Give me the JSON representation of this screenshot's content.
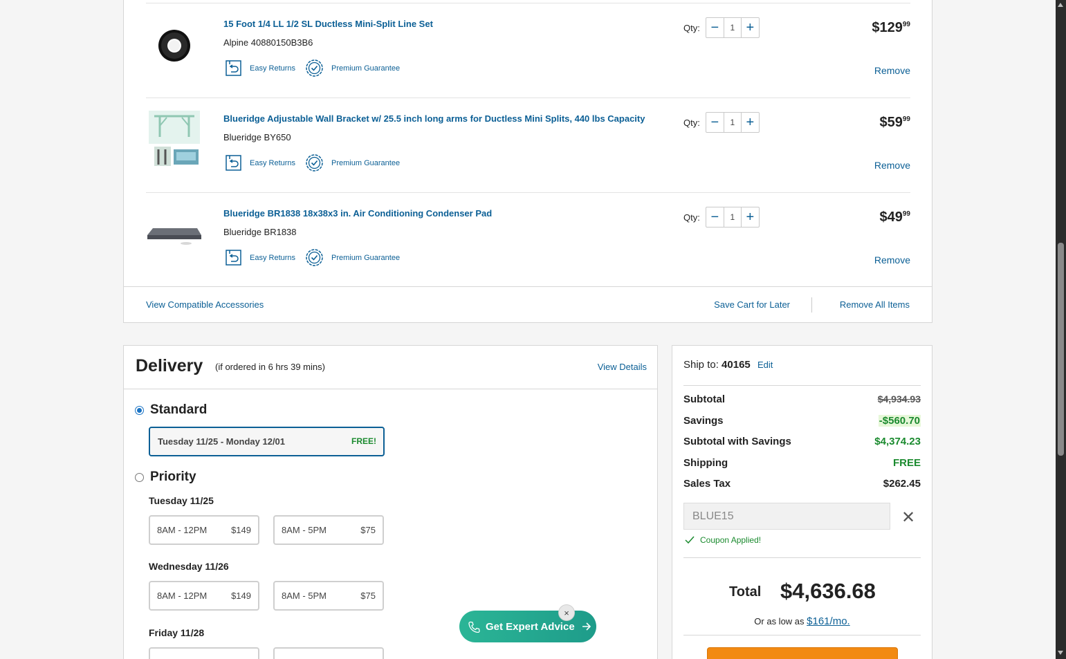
{
  "cart": {
    "items": [
      {
        "title": "15 Foot 1/4 LL 1/2 SL Ductless Mini-Split Line Set",
        "sku": "Alpine 40880150B3B6",
        "returns": "Easy Returns",
        "guarantee": "Premium Guarantee",
        "qty_label": "Qty:",
        "qty": "1",
        "price_dollars": "$129",
        "price_cents": "99",
        "remove": "Remove",
        "image": "line-set-coil"
      },
      {
        "title": "Blueridge Adjustable Wall Bracket w/ 25.5 inch long arms for Ductless Mini Splits, 440 lbs Capacity",
        "sku": "Blueridge BY650",
        "returns": "Easy Returns",
        "guarantee": "Premium Guarantee",
        "qty_label": "Qty:",
        "qty": "1",
        "price_dollars": "$59",
        "price_cents": "99",
        "remove": "Remove",
        "image": "wall-bracket"
      },
      {
        "title": "Blueridge BR1838 18x38x3 in. Air Conditioning Condenser Pad",
        "sku": "Blueridge BR1838",
        "returns": "Easy Returns",
        "guarantee": "Premium Guarantee",
        "qty_label": "Qty:",
        "qty": "1",
        "price_dollars": "$49",
        "price_cents": "99",
        "remove": "Remove",
        "image": "condenser-pad"
      }
    ],
    "footer": {
      "accessories": "View Compatible Accessories",
      "save": "Save Cart for Later",
      "remove_all": "Remove All Items"
    }
  },
  "delivery": {
    "title": "Delivery",
    "subtitle": "(if ordered in 6 hrs 39 mins)",
    "details": "View Details",
    "standard": {
      "label": "Standard",
      "dates": "Tuesday 11/25 - Monday 12/01",
      "price": "FREE!"
    },
    "priority": {
      "label": "Priority",
      "days": [
        {
          "day": "Tuesday 11/25",
          "slots": [
            {
              "time": "8AM - 12PM",
              "price": "$149"
            },
            {
              "time": "8AM - 5PM",
              "price": "$75"
            }
          ]
        },
        {
          "day": "Wednesday 11/26",
          "slots": [
            {
              "time": "8AM - 12PM",
              "price": "$149"
            },
            {
              "time": "8AM - 5PM",
              "price": "$75"
            }
          ]
        },
        {
          "day": "Friday 11/28",
          "slots": []
        }
      ]
    }
  },
  "summary": {
    "ship_label": "Ship to:",
    "zip": "40165",
    "edit": "Edit",
    "subtotal_label": "Subtotal",
    "subtotal": "$4,934.93",
    "savings_label": "Savings",
    "savings": "-$560.70",
    "subtotal_savings_label": "Subtotal with Savings",
    "subtotal_savings": "$4,374.23",
    "shipping_label": "Shipping",
    "shipping": "FREE",
    "tax_label": "Sales Tax",
    "tax": "$262.45",
    "coupon_code": "BLUE15",
    "coupon_status": "Coupon Applied!",
    "total_label": "Total",
    "total": "$4,636.68",
    "monthly_prefix": "Or as low as",
    "monthly": "$161/mo."
  },
  "expert": {
    "label": "Get Expert Advice",
    "close": "×"
  },
  "colors": {
    "link": "#0b5f95",
    "green": "#1a8a2e",
    "expert": "#2bb596",
    "checkout": "#f28a12"
  }
}
